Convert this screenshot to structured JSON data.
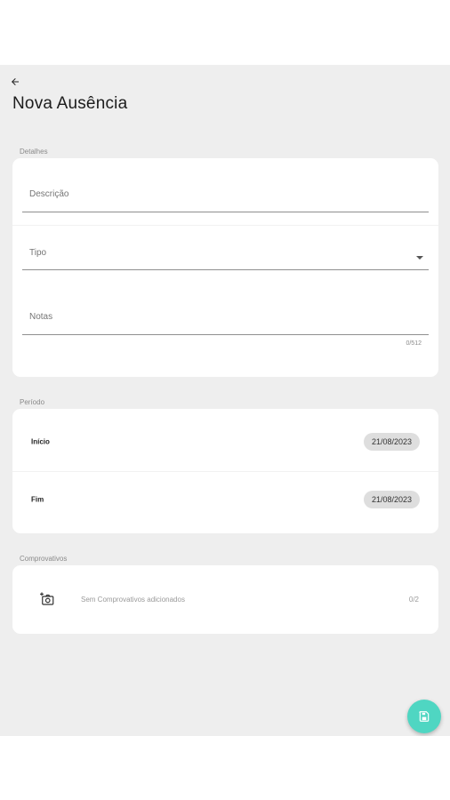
{
  "header": {
    "back_icon": "arrow-left-icon",
    "title": "Nova Ausência"
  },
  "details": {
    "section_label": "Detalhes",
    "description_placeholder": "Descrição",
    "type_placeholder": "Tipo",
    "notes_placeholder": "Notas",
    "notes_counter": "0/512"
  },
  "period": {
    "section_label": "Período",
    "start_label": "Início",
    "start_date": "21/08/2023",
    "end_label": "Fim",
    "end_date": "21/08/2023"
  },
  "proofs": {
    "section_label": "Comprovativos",
    "add_icon": "add-photo-icon",
    "empty_text": "Sem Comprovativos adicionados",
    "count": "0/2"
  },
  "fab": {
    "icon": "save-icon",
    "color": "#4fd6c2"
  },
  "colors": {
    "background": "#eeeeee",
    "card": "#ffffff",
    "accent": "#4fd6c2"
  }
}
